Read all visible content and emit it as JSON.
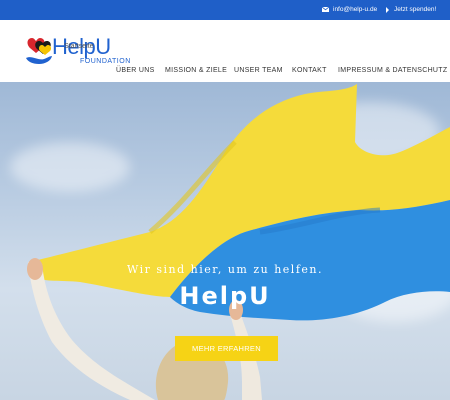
{
  "topbar": {
    "email": "info@help-u.de",
    "donate": "Jetzt spenden!"
  },
  "logo": {
    "brand": "HelpU",
    "sub": "FOUNDATION",
    "overlap_text": "Startseite"
  },
  "nav": {
    "items": [
      "ÜBER UNS",
      "MISSION & ZIELE",
      "UNSER TEAM",
      "KONTAKT",
      "IMPRESSUM & DATENSCHUTZ"
    ]
  },
  "hero": {
    "tagline": "Wir sind hier, um zu helfen.",
    "title": "HelpU",
    "cta": "MEHR ERFAHREN"
  },
  "colors": {
    "topbar": "#1f5fc8",
    "brand_blue": "#2062cf",
    "cta_yellow": "#f6d315",
    "flag_yellow": "#f5db3a",
    "flag_blue": "#2f8fe0"
  }
}
